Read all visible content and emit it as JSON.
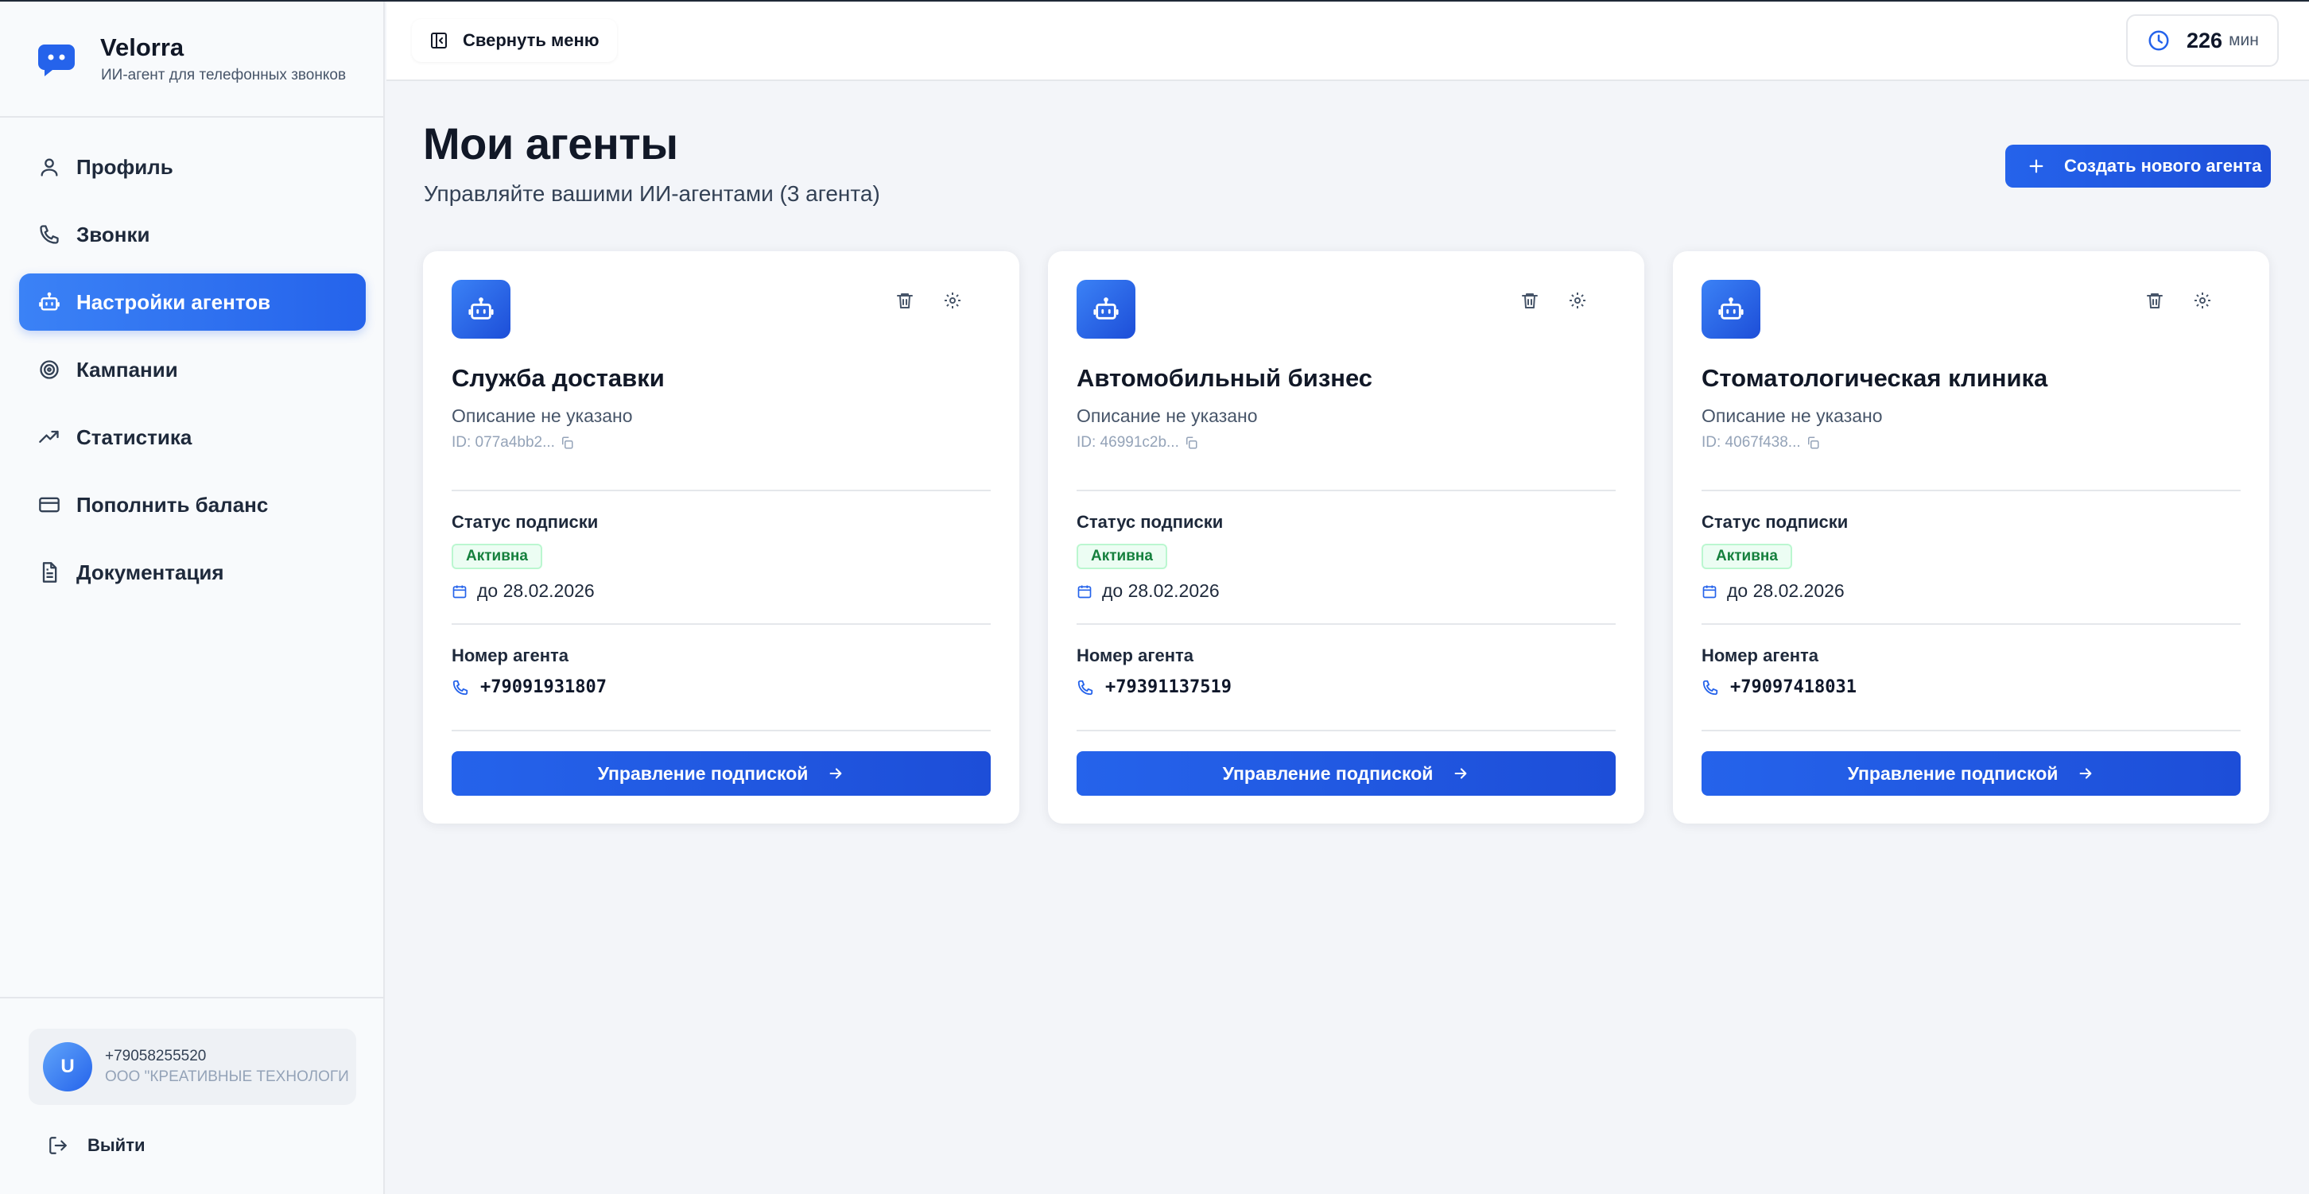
{
  "brand": {
    "name": "Velorra",
    "subtitle": "ИИ-агент для телефонных звонков"
  },
  "sidebar": {
    "items": [
      {
        "label": "Профиль",
        "icon": "user-icon",
        "active": false
      },
      {
        "label": "Звонки",
        "icon": "phone-icon",
        "active": false
      },
      {
        "label": "Настройки агентов",
        "icon": "bot-icon",
        "active": true
      },
      {
        "label": "Кампании",
        "icon": "target-icon",
        "active": false
      },
      {
        "label": "Статистика",
        "icon": "trending-up-icon",
        "active": false
      },
      {
        "label": "Пополнить баланс",
        "icon": "credit-card-icon",
        "active": false
      },
      {
        "label": "Документация",
        "icon": "document-icon",
        "active": false
      }
    ],
    "user": {
      "initial": "U",
      "phone": "+79058255520",
      "org": "ООО \"КРЕАТИВНЫЕ ТЕХНОЛОГИИ\""
    },
    "logout_label": "Выйти"
  },
  "header": {
    "collapse_label": "Свернуть меню",
    "minutes_value": "226",
    "minutes_unit": "мин"
  },
  "main": {
    "title": "Мои агенты",
    "subtitle": "Управляйте вашими ИИ-агентами (3 агента)",
    "create_label": "Создать нового агента",
    "agents": [
      {
        "name": "Служба доставки",
        "description": "Описание не указано",
        "id": "ID: 077a4bb2...",
        "status_label": "Статус подписки",
        "status": "Активна",
        "until": "до 28.02.2026",
        "number_label": "Номер агента",
        "phone": "+79091931807",
        "manage_label": "Управление подпиской"
      },
      {
        "name": "Автомобильный бизнес",
        "description": "Описание не указано",
        "id": "ID: 46991c2b...",
        "status_label": "Статус подписки",
        "status": "Активна",
        "until": "до 28.02.2026",
        "number_label": "Номер агента",
        "phone": "+79391137519",
        "manage_label": "Управление подпиской"
      },
      {
        "name": "Стоматологическая клиника",
        "description": "Описание не указано",
        "id": "ID: 4067f438...",
        "status_label": "Статус подписки",
        "status": "Активна",
        "until": "до 28.02.2026",
        "number_label": "Номер агента",
        "phone": "+79097418031",
        "manage_label": "Управление подпиской"
      }
    ]
  },
  "colors": {
    "accent": "#2563eb",
    "active_badge_bg": "#ecfdf3",
    "active_badge_text": "#15803d",
    "sidebar_bg": "#f8fafc",
    "page_bg": "#f3f5f9"
  }
}
